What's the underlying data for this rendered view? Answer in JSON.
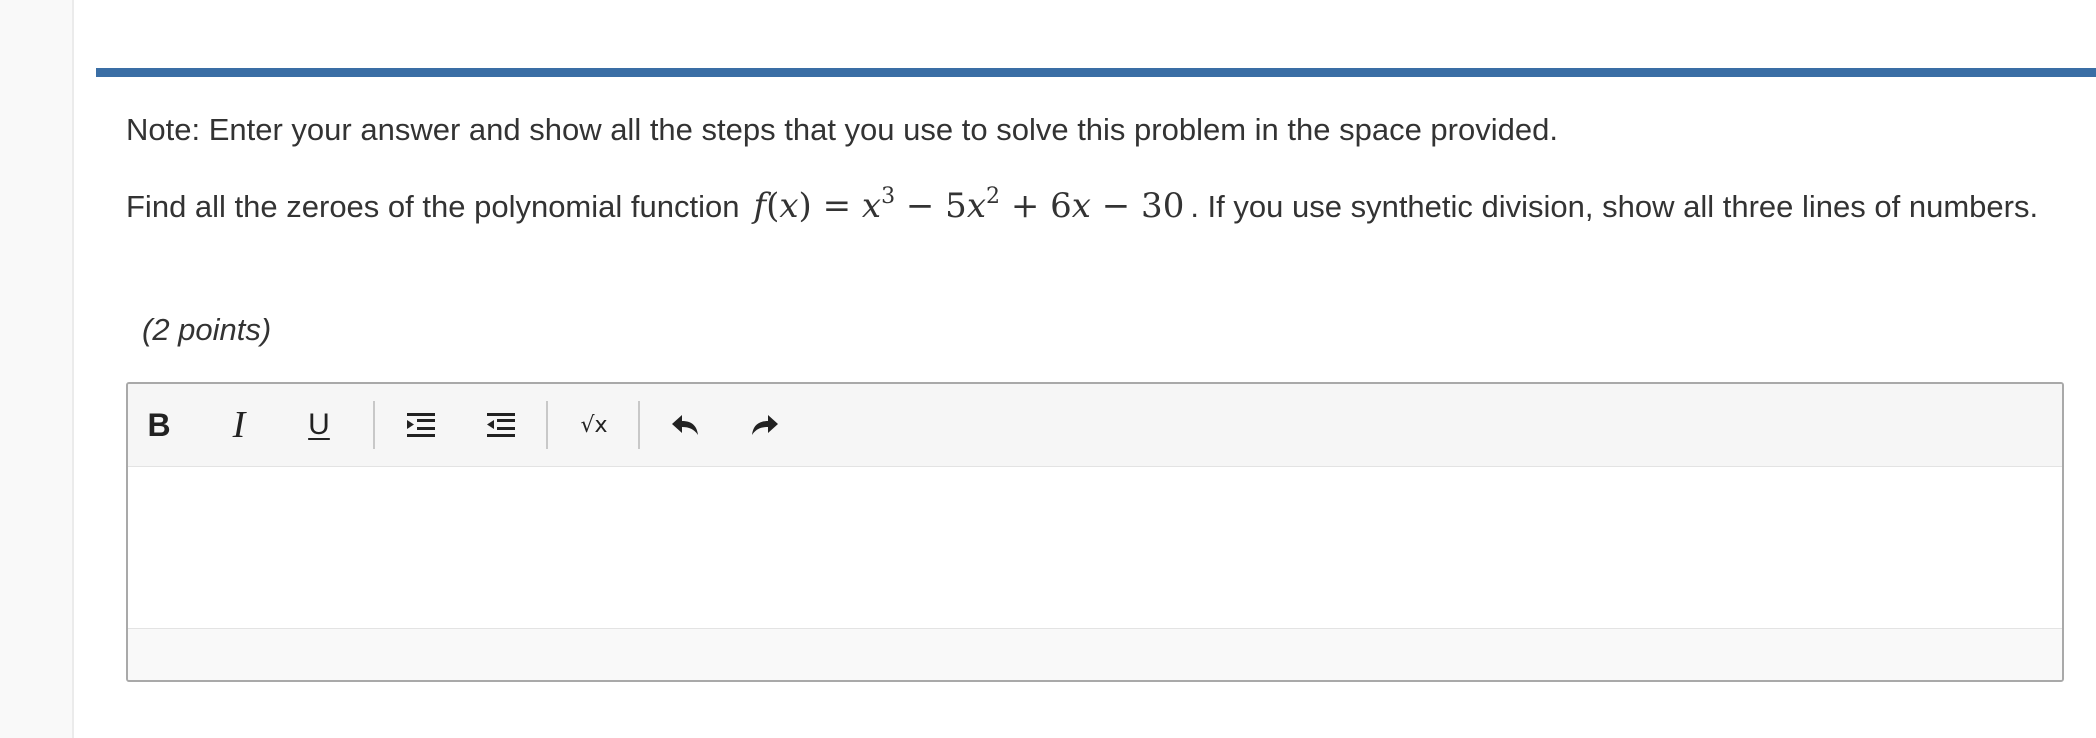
{
  "question": {
    "note": "Note: Enter your answer and show all the steps that you use to solve this problem in the space provided.",
    "prompt_before": "Find all the zeroes of the polynomial function",
    "formula": {
      "f": "f",
      "lparen": "(",
      "x": "x",
      "rparen_eq": ") = ",
      "term1": "x",
      "exp1": "3",
      "op1": " − 5",
      "term2": "x",
      "exp2": "2",
      "op2": " + 6",
      "term3": "x",
      "const": " − 30"
    },
    "prompt_after": ". If you use synthetic division, show all three lines of numbers.",
    "points": "(2 points)"
  },
  "editor": {
    "toolbar": {
      "bold_label": "B",
      "italic_label": "I",
      "underline_label": "U",
      "math_label": "√x",
      "icons": [
        "bold-icon",
        "italic-icon",
        "underline-icon",
        "indent-icon",
        "outdent-icon",
        "square-root-icon",
        "undo-icon",
        "redo-icon"
      ]
    },
    "content": ""
  },
  "colors": {
    "accent_bar": "#3a6ea5",
    "text": "#333333",
    "toolbar_bg": "#f6f6f6"
  }
}
